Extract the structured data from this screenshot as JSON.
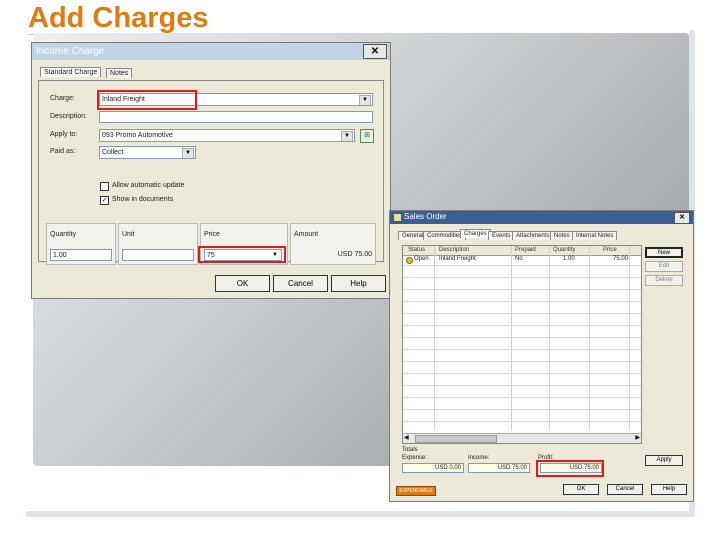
{
  "slide": {
    "title": "Add Charges"
  },
  "income_charge": {
    "title": "Income Charge",
    "close_glyph": "✕",
    "tabs": [
      "Standard Charge",
      "Notes"
    ],
    "charge_label": "Charge:",
    "charge_value": "Inland Freight",
    "description_label": "Description:",
    "description_value": "",
    "apply_to_label": "Apply to:",
    "apply_to_value": "093 Promo Automotive",
    "paid_as_label": "Paid as:",
    "paid_as_value": "Collect",
    "allow_auto_update": "Allow automatic update",
    "show_in_documents": "Show in documents",
    "show_in_documents_checked": true,
    "allow_auto_update_checked": false,
    "quantity_label": "Quantity",
    "quantity_value": "1.00",
    "unit_label": "Unit",
    "unit_value": "",
    "price_label": "Price",
    "price_value": "75",
    "amount_label": "Amount",
    "amount_value": "USD 75.00",
    "ok": "OK",
    "cancel": "Cancel",
    "help": "Help"
  },
  "sales_order": {
    "title": "Sales Order",
    "close_glyph": "✕",
    "tabs": [
      "General",
      "Commodities",
      "Charges",
      "Events",
      "Attachments",
      "Notes",
      "Internal Notes"
    ],
    "active_tab": "Charges",
    "columns": [
      "Status",
      "Description",
      "Prepaid",
      "Quantity",
      "Price"
    ],
    "rows": [
      {
        "status": "Open",
        "description": "Inland Freight",
        "prepaid": "No",
        "quantity": "1.00",
        "price": "75.00"
      }
    ],
    "side_buttons": [
      "New",
      "Edit",
      "Delete"
    ],
    "totals_label": "Totals",
    "expense_label": "Expense:",
    "expense_value": "USD 0.00",
    "income_label": "Income:",
    "income_value": "USD 75.00",
    "profit_label": "Profit:",
    "profit_value": "USD 75.00",
    "apply_button": "Apply",
    "status_badge": "EXPENDABLE",
    "ok": "OK",
    "cancel": "Cancel",
    "help": "Help"
  },
  "colors": {
    "title": "#e07b12",
    "highlight": "#e11b1b",
    "dialog_bg": "#ece9d8"
  }
}
